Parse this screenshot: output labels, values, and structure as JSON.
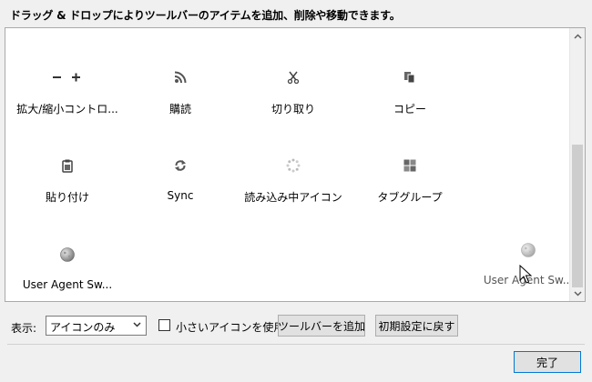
{
  "instruction": "ドラッグ & ドロップによりツールバーのアイテムを追加、削除や移動できます。",
  "palette": {
    "items": [
      {
        "label": "拡大/縮小コントロ...",
        "icon": "zoom-controls-icon"
      },
      {
        "label": "購読",
        "icon": "rss-icon"
      },
      {
        "label": "切り取り",
        "icon": "scissors-icon"
      },
      {
        "label": "コピー",
        "icon": "copy-icon"
      },
      {
        "label": "貼り付け",
        "icon": "clipboard-icon"
      },
      {
        "label": "Sync",
        "icon": "sync-icon"
      },
      {
        "label": "読み込み中アイコン",
        "icon": "throbber-icon"
      },
      {
        "label": "タブグループ",
        "icon": "tab-groups-icon"
      },
      {
        "label": "User Agent Sw...",
        "icon": "globe-icon"
      }
    ],
    "dragging_item": {
      "label": "User Agent Sw...",
      "icon": "globe-icon"
    }
  },
  "bottom": {
    "show_label": "表示:",
    "show_select_value": "アイコンのみ",
    "small_icons_label": "小さいアイコンを使用",
    "small_icons_checked": false,
    "add_toolbar_label": "ツールバーを追加",
    "restore_default_label": "初期設定に戻す"
  },
  "done_label": "完了"
}
